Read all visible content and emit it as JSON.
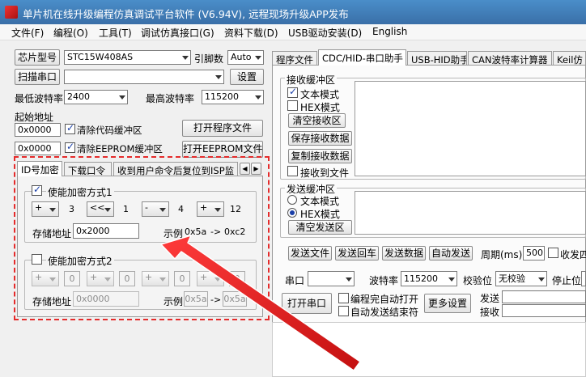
{
  "window": {
    "title": "单片机在线升级编程仿真调试平台软件 (V6.94V), 远程现场升级APP发布"
  },
  "menu": [
    "文件(F)",
    "编程(O)",
    "工具(T)",
    "调试仿真接口(G)",
    "资料下载(D)",
    "USB驱动安装(D)",
    "English"
  ],
  "left": {
    "chip_btn": "芯片型号",
    "chip_value": "STC15W408AS",
    "pins_label": "引脚数",
    "pins_value": "Auto",
    "scan_btn": "扫描串口",
    "port_value": "",
    "settings_btn": "设置",
    "min_baud_label": "最低波特率",
    "min_baud_value": "2400",
    "max_baud_label": "最高波特率",
    "max_baud_value": "115200",
    "start_addr_label": "起始地址",
    "code_addr": "0x0000",
    "clear_code_label": "清除代码缓冲区",
    "open_prog_btn": "打开程序文件",
    "eeprom_addr": "0x0000",
    "clear_eeprom_label": "清除EEPROM缓冲区",
    "open_eeprom_btn": "打开EEPROM文件",
    "tabs": [
      "ID号加密",
      "下载口令",
      "收到用户命令后复位到ISP监"
    ]
  },
  "enc1": {
    "enable_label": "使能加密方式1",
    "ops": [
      "+",
      "<<",
      "-",
      "+"
    ],
    "vals": [
      "3",
      "1",
      "4",
      "12"
    ],
    "addr_label": "存储地址",
    "addr_value": "0x2000",
    "example_label": "示例",
    "example_in": "0x5a",
    "arrow": "->",
    "example_out": "0xc2"
  },
  "enc2": {
    "enable_label": "使能加密方式2",
    "ops": [
      "+",
      "+",
      "+",
      "+"
    ],
    "vals": [
      "0",
      "0",
      "0",
      "0"
    ],
    "addr_label": "存储地址",
    "addr_value": "0x0000",
    "example_label": "示例",
    "example_in": "0x5a",
    "arrow": "->",
    "example_out": "0x5a"
  },
  "right": {
    "tabs": [
      "程序文件",
      "CDC/HID-串口助手",
      "USB-HID助手",
      "CAN波特率计算器",
      "Keil仿"
    ],
    "recv_group": "接收缓冲区",
    "recv_text_mode": "文本模式",
    "recv_hex_mode": "HEX模式",
    "clear_recv_btn": "清空接收区",
    "save_recv_btn": "保存接收数据",
    "copy_recv_btn": "复制接收数据",
    "recv_to_file": "接收到文件",
    "send_group": "发送缓冲区",
    "send_text_mode": "文本模式",
    "send_hex_mode": "HEX模式",
    "clear_send_btn": "清空发送区",
    "send_file_btn": "发送文件",
    "send_cr_btn": "发送回车",
    "send_data_btn": "发送数据",
    "auto_send_btn": "自动发送",
    "period_label": "周期(ms)",
    "period_value": "500",
    "recv_send_label": "收发四",
    "port_label": "串口",
    "port_value": "",
    "baud_label": "波特率",
    "baud_value": "115200",
    "parity_label": "校验位",
    "parity_value": "无校验",
    "stop_label": "停止位",
    "open_port_btn": "打开串口",
    "auto_open_label": "编程完自动打开",
    "auto_send_end_label": "自动发送结束符",
    "more_btn": "更多设置",
    "send_stat": "发送",
    "recv_stat": "接收"
  }
}
